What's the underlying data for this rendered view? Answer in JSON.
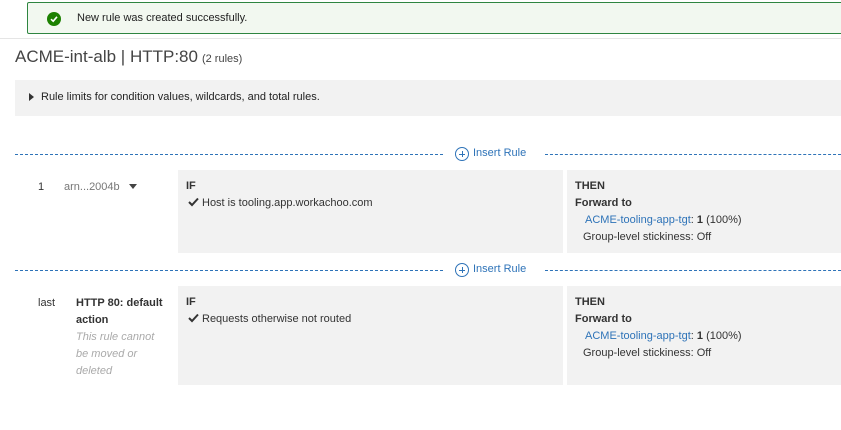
{
  "alert": {
    "message": "New rule was created successfully.",
    "color": "#1d8102"
  },
  "header": {
    "title": "ACME-int-alb | HTTP:80",
    "rule_count": "(2 rules)"
  },
  "limits": {
    "label": "Rule limits for condition values, wildcards, and total rules."
  },
  "insert_rule_label": "Insert Rule",
  "rules": [
    {
      "number": "1",
      "arn": "arn...2004b",
      "if_label": "IF",
      "condition": "Host is tooling.app.workachoo.com",
      "then_label": "THEN",
      "forward_label": "Forward to",
      "target_group": "ACME-tooling-app-tgt",
      "weight_sep": ":",
      "weight": "1",
      "weight_pct": "(100%)",
      "stickiness_label": "Group-level stickiness:",
      "stickiness_value": "Off"
    },
    {
      "number": "last",
      "name": "HTTP 80: default action",
      "note": "This rule cannot be moved or deleted",
      "if_label": "IF",
      "condition": "Requests otherwise not routed",
      "then_label": "THEN",
      "forward_label": "Forward to",
      "target_group": "ACME-tooling-app-tgt",
      "weight_sep": ":",
      "weight": "1",
      "weight_pct": "(100%)",
      "stickiness_label": "Group-level stickiness:",
      "stickiness_value": "Off"
    }
  ],
  "colors": {
    "link": "#2e73b8",
    "panel": "#f2f2f2",
    "success": "#1d8102"
  }
}
